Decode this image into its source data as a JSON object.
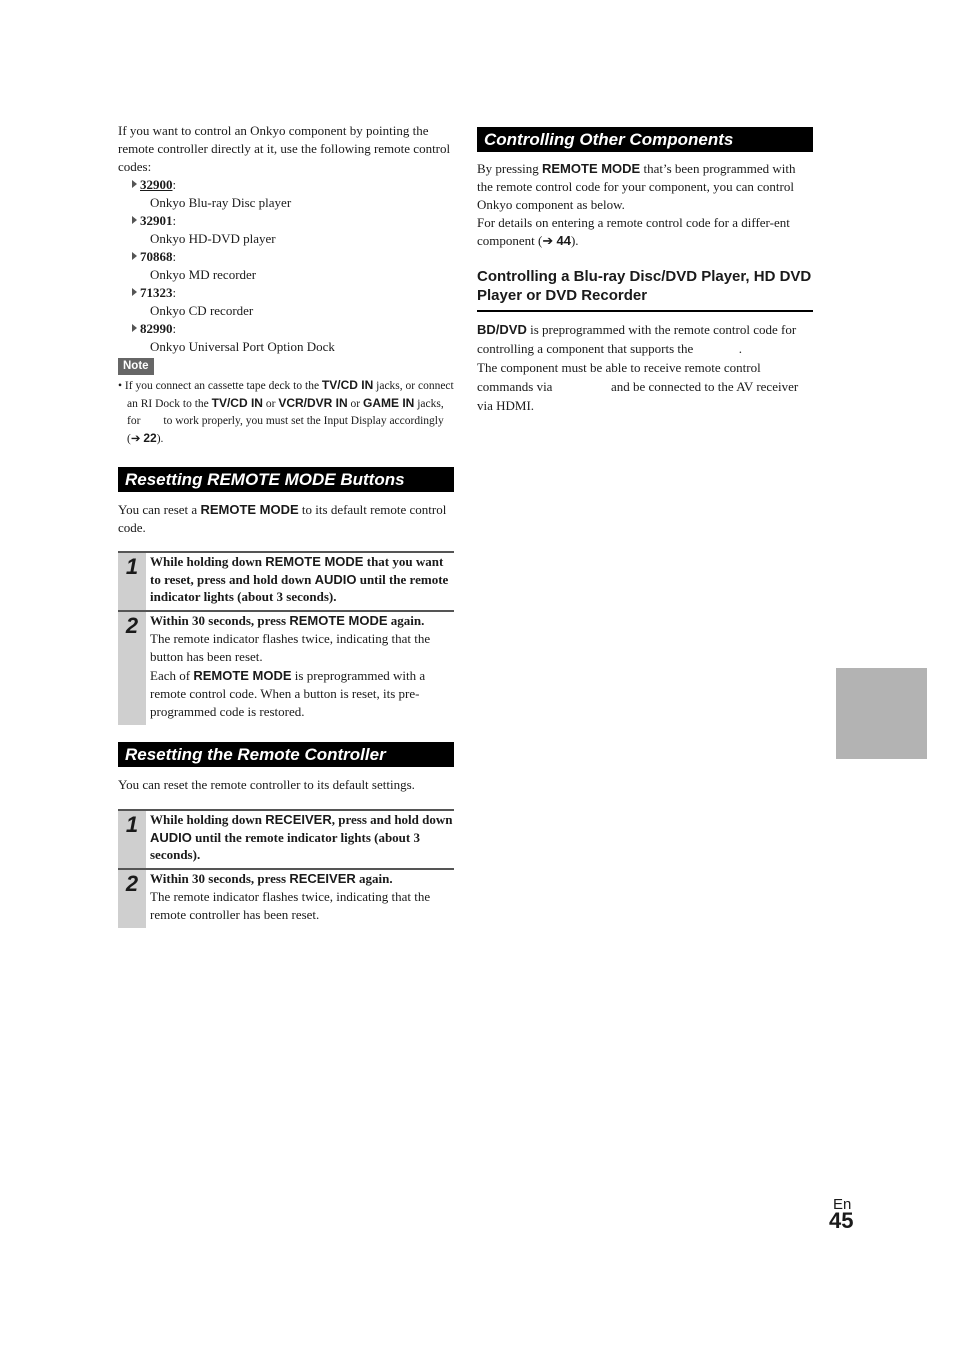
{
  "left": {
    "intro": "If you want to control an Onkyo component by pointing the remote controller directly at it, use the following remote control codes:",
    "codes": [
      {
        "code": "32900",
        "desc": "Onkyo Blu-ray Disc player"
      },
      {
        "code": "32901",
        "desc": "Onkyo HD-DVD player"
      },
      {
        "code": "70868",
        "desc": "Onkyo MD recorder"
      },
      {
        "code": "71323",
        "desc": "Onkyo CD recorder"
      },
      {
        "code": "82990",
        "desc": "Onkyo Universal Port Option Dock"
      }
    ],
    "note": {
      "label": "Note",
      "t1": "If you connect an cassette tape deck to the ",
      "k1": "TV/CD IN",
      "t2": " jacks, or connect an RI Dock to the ",
      "k2": "TV/CD IN",
      "t3": " or ",
      "k3": "VCR/DVR IN",
      "t4": " or ",
      "k4": "GAME IN",
      "t5": " jacks, for        to work properly, you must set the Input Display accordingly (",
      "arrow": "➔ ",
      "ref": "22",
      "t6": ")."
    },
    "sec1": {
      "title": "Resetting REMOTE MODE Buttons",
      "intro_a": "You can reset a ",
      "intro_k": "REMOTE MODE",
      "intro_b": " to its default remote control code.",
      "steps": [
        {
          "num": "1",
          "a": "While holding down ",
          "k1": "REMOTE MODE",
          "b": " that you want to reset, press and hold down ",
          "k2": "AUDIO",
          "c": " until the remote indicator lights (about 3 seconds)."
        },
        {
          "num": "2",
          "a": "Within 30 seconds, press ",
          "k1": "REMOTE MODE",
          "b": " again.",
          "d1": "The remote indicator flashes twice, indicating that the button has been reset.",
          "d2a": "Each of ",
          "d2k": "REMOTE MODE",
          "d2b": " is preprogrammed with a remote control code. When a button is reset, its pre-programmed code is restored."
        }
      ]
    },
    "sec2": {
      "title": "Resetting the Remote Controller",
      "intro": "You can reset the remote controller to its default settings.",
      "steps": [
        {
          "num": "1",
          "a": "While holding down ",
          "k1": "RECEIVER",
          "b": ", press and hold down ",
          "k2": "AUDIO",
          "c": " until the remote indicator lights (about 3 seconds)."
        },
        {
          "num": "2",
          "a": "Within 30 seconds, press ",
          "k1": "RECEIVER",
          "b": " again.",
          "d1": "The remote indicator flashes twice, indicating that the remote controller has been reset."
        }
      ]
    }
  },
  "right": {
    "sec": {
      "title": "Controlling Other Components",
      "p1a": "By pressing ",
      "p1k": "REMOTE MODE",
      "p1b": " that’s been programmed with the remote control code for your component, you can control Onkyo component as below.",
      "p2a": "For details on entering a remote control code for a differ-ent component (",
      "p2arrow": "➔ ",
      "p2ref": "44",
      "p2b": ")."
    },
    "sub": {
      "title": "Controlling a Blu-ray Disc/DVD Player, HD DVD Player or DVD Recorder",
      "k": "BD/DVD",
      "t1": " is preprogrammed with the remote control code for controlling a component that supports the              .",
      "t2": "The component must be able to receive remote control commands via                  and be connected to the AV receiver via HDMI."
    }
  },
  "footer": {
    "lang": "En",
    "page": "45"
  }
}
